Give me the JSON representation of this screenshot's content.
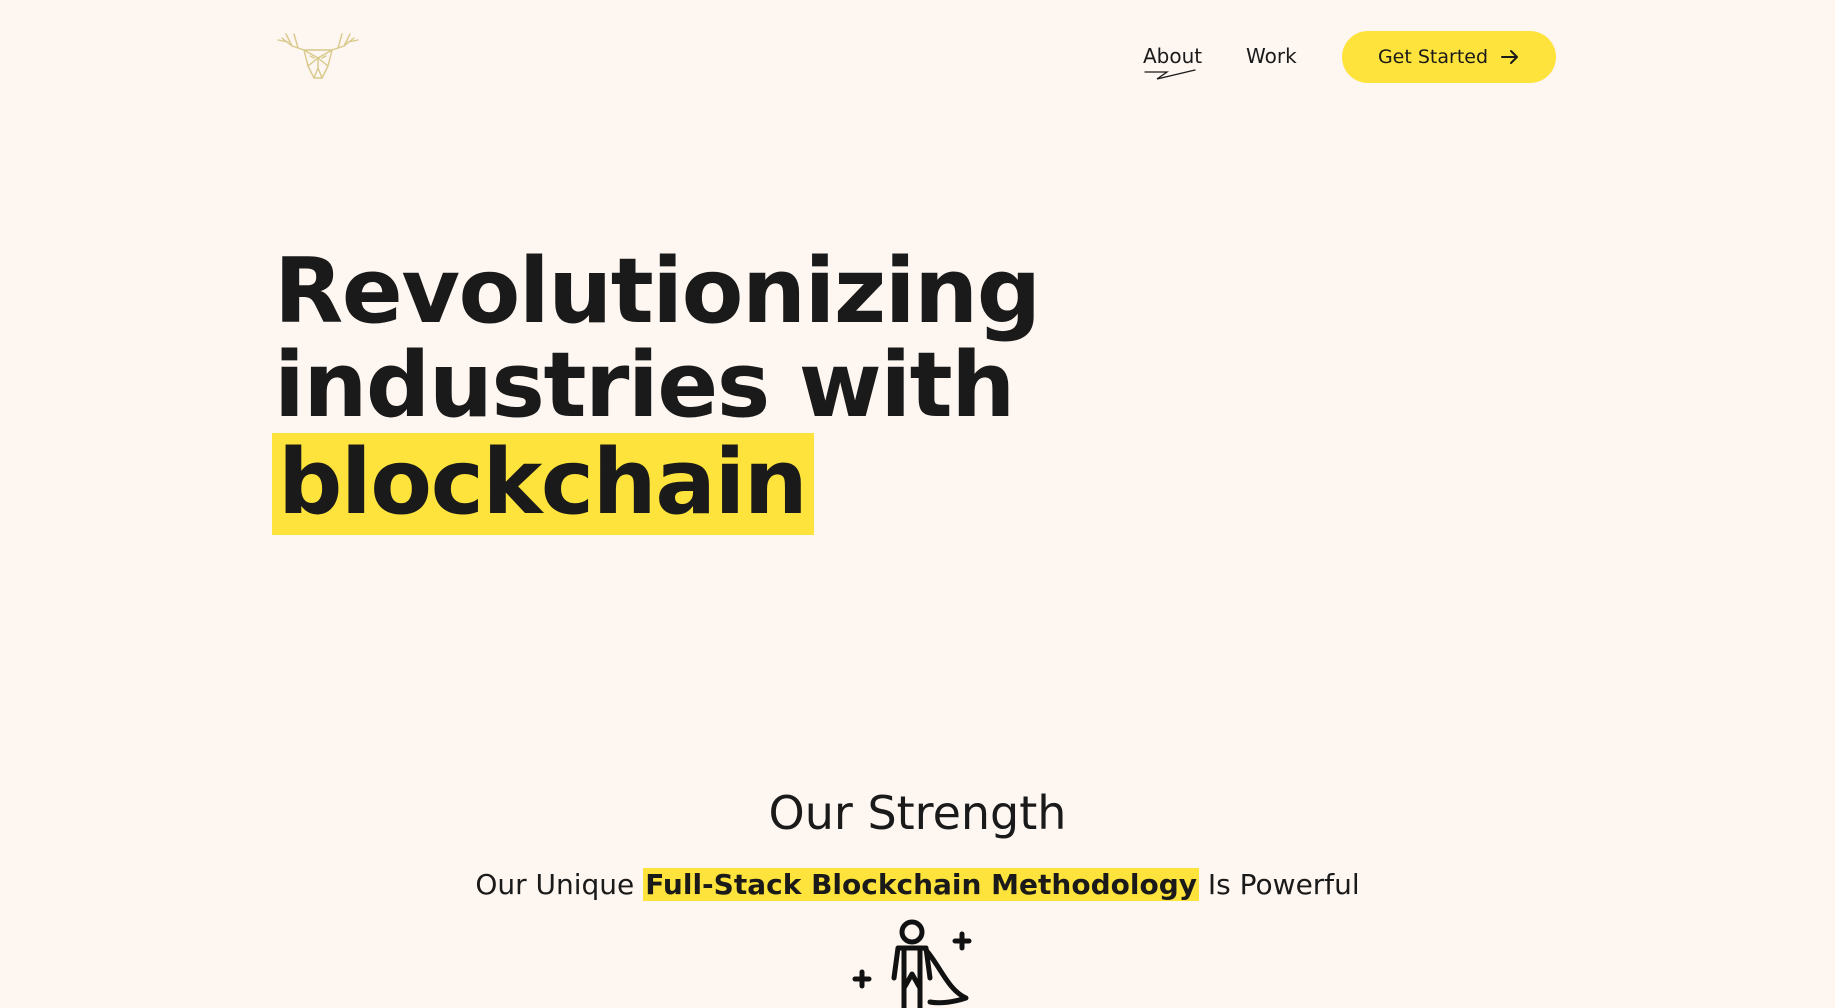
{
  "colors": {
    "background": "#fdf6f1",
    "accent": "#fde33b",
    "text": "#1a1a1a",
    "logo": "#d8c98a"
  },
  "header": {
    "logo_icon": "moose-head-icon",
    "nav": {
      "about_label": "About",
      "work_label": "Work"
    },
    "cta": {
      "label": "Get Started",
      "icon": "arrow-right-icon"
    }
  },
  "hero": {
    "line1": "Revolutionizing",
    "line2": "industries with",
    "line3_highlight": "blockchain"
  },
  "strength": {
    "title": "Our Strength",
    "subtitle_before": "Our Unique ",
    "subtitle_highlight": "Full-Stack Blockchain Methodology",
    "subtitle_after": " Is Powerful",
    "illustration_icon": "superhero-icon"
  }
}
